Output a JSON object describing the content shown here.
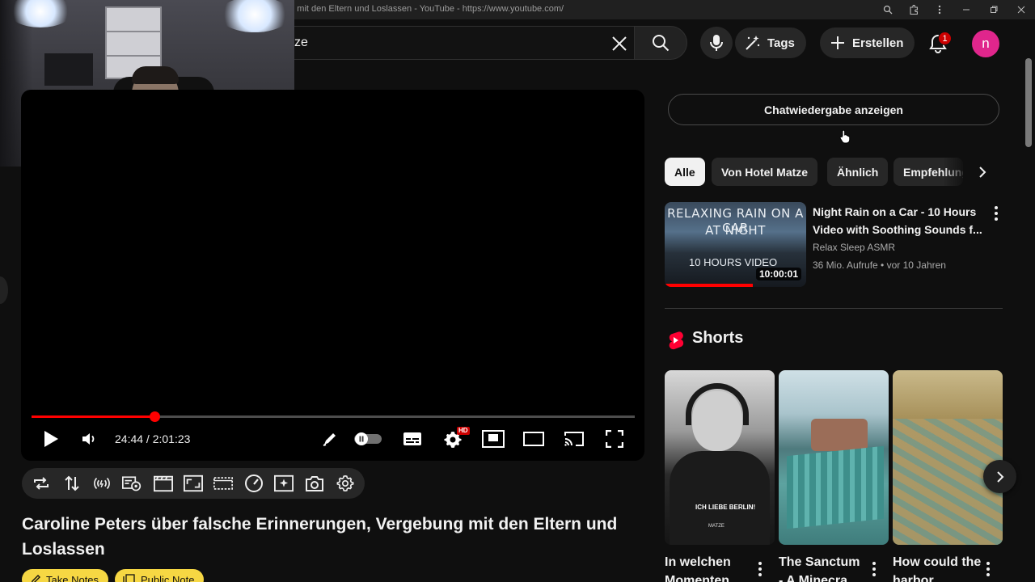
{
  "browser": {
    "title": "ng mit den Eltern und Loslassen - YouTube - https://www.youtube.com/"
  },
  "header": {
    "search_value": "ze",
    "tags_label": "Tags",
    "create_label": "Erstellen",
    "notification_count": "1",
    "avatar_initial": "n"
  },
  "player": {
    "time": "24:44 / 2:01:23",
    "progress": 0.2044,
    "hd_badge": "HD"
  },
  "video": {
    "title": "Caroline Peters über falsche Erinnerungen, Vergebung mit den Eltern und Loslassen",
    "take_notes_label": "Take Notes",
    "public_note_label": "Public Note"
  },
  "sidebar": {
    "chat_button": "Chatwiedergabe anzeigen",
    "chips": [
      "Alle",
      "Von Hotel Matze",
      "Ähnlich",
      "Empfehlungen"
    ],
    "recommendation": {
      "thumb_line1": "RELAXING RAIN ON A CAR",
      "thumb_line2": "AT NIGHT",
      "thumb_line3": "10 HOURS VIDEO",
      "duration": "10:00:01",
      "watched_fraction": 0.62,
      "title": "Night Rain on a Car - 10 Hours Video with Soothing Sounds f...",
      "channel": "Relax Sleep ASMR",
      "meta": "36 Mio. Aufrufe • vor 10 Jahren"
    },
    "shorts": {
      "heading": "Shorts",
      "items": [
        {
          "title": "In welchen Momenten",
          "thumb_text": "ICH LIEBE BERLIN!",
          "thumb_text2": "MATZE"
        },
        {
          "title": "The Sanctum - A Minecra"
        },
        {
          "title": "How could the harbor"
        }
      ]
    }
  },
  "colors": {
    "accent_red": "#ff0000",
    "avatar": "#e0268c",
    "note_yellow": "#f6d743"
  }
}
